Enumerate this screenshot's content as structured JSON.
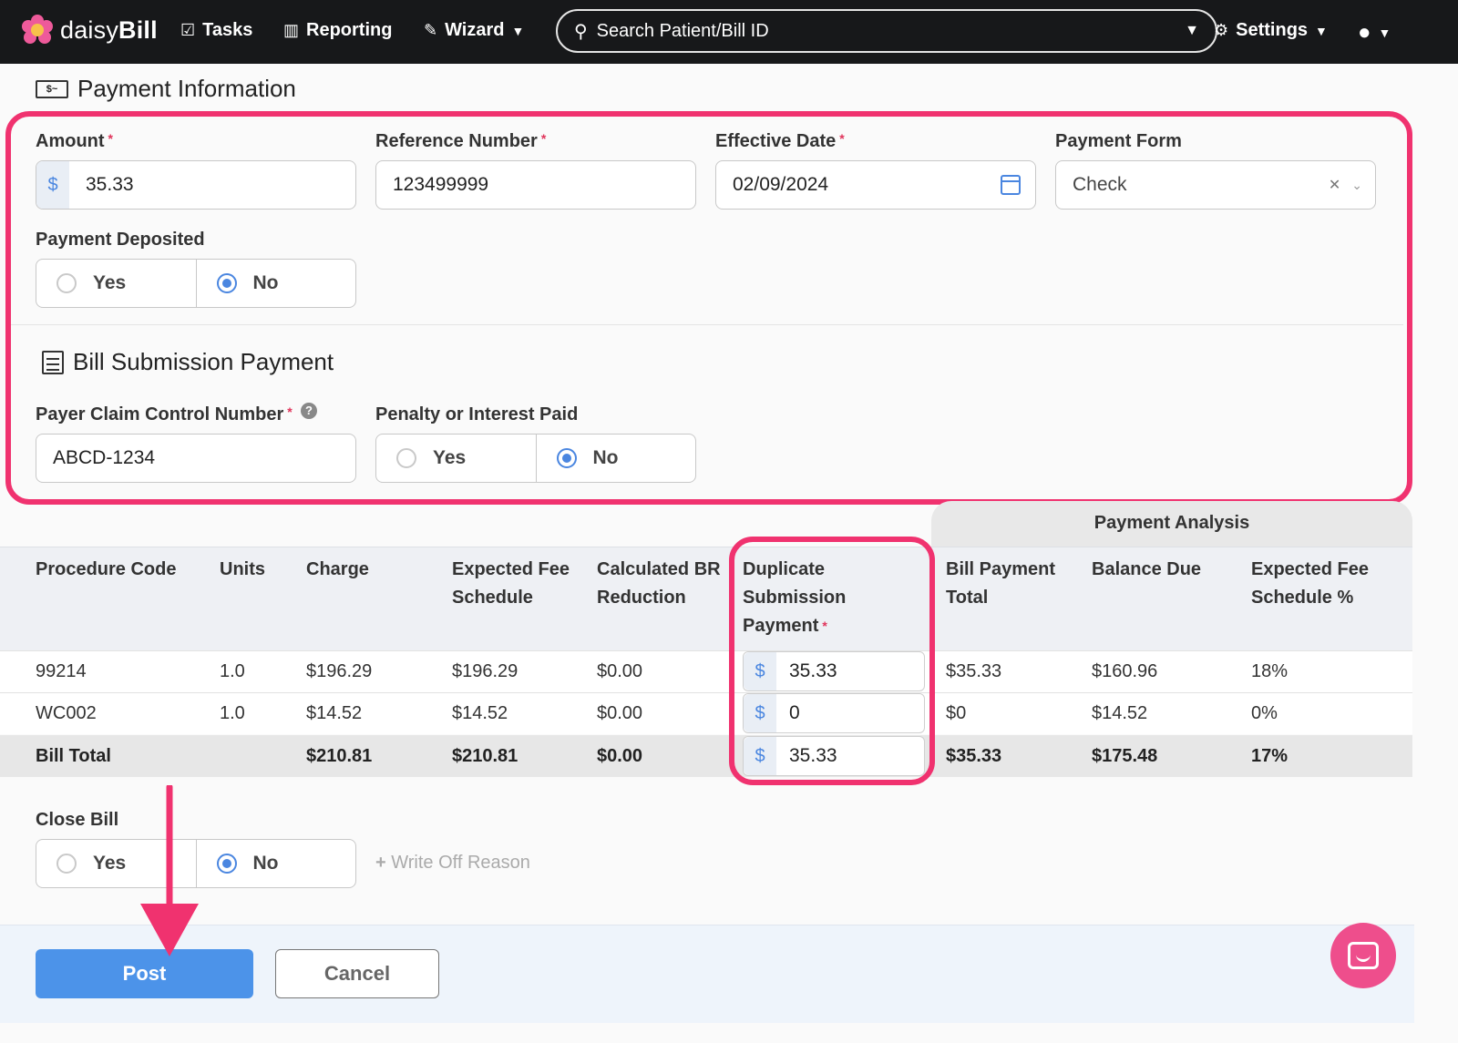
{
  "nav": {
    "brand_light": "daisy",
    "brand_bold": "Bill",
    "tasks": "Tasks",
    "reporting": "Reporting",
    "wizard": "Wizard",
    "search_placeholder": "Search Patient/Bill ID",
    "settings": "Settings"
  },
  "payment_info": {
    "title": "Payment Information",
    "amount_label": "Amount",
    "amount_value": "35.33",
    "currency": "$",
    "reference_label": "Reference Number",
    "reference_value": "123499999",
    "date_label": "Effective Date",
    "date_value": "02/09/2024",
    "form_label": "Payment Form",
    "form_value": "Check",
    "deposited_label": "Payment Deposited",
    "yes": "Yes",
    "no": "No",
    "deposited_selected": "No"
  },
  "bill_submission": {
    "title": "Bill Submission Payment",
    "pccn_label": "Payer Claim Control Number",
    "pccn_value": "ABCD-1234",
    "penalty_label": "Penalty or Interest Paid",
    "penalty_selected": "No"
  },
  "table": {
    "analysis_header": "Payment Analysis",
    "headers": {
      "procedure": "Procedure Code",
      "units": "Units",
      "charge": "Charge",
      "fee_1": "Expected Fee",
      "fee_2": "Schedule",
      "br_1": "Calculated BR",
      "br_2": "Reduction",
      "dup_1": "Duplicate",
      "dup_2": "Submission",
      "dup_3": "Payment",
      "bpt_1": "Bill Payment",
      "bpt_2": "Total",
      "balance": "Balance Due",
      "pct_1": "Expected Fee",
      "pct_2": "Schedule %"
    },
    "rows": [
      {
        "code": "99214",
        "units": "1.0",
        "charge": "$196.29",
        "fee": "$196.29",
        "br": "$0.00",
        "dup": "35.33",
        "bpt": "$35.33",
        "balance": "$160.96",
        "pct": "18%"
      },
      {
        "code": "WC002",
        "units": "1.0",
        "charge": "$14.52",
        "fee": "$14.52",
        "br": "$0.00",
        "dup": "0",
        "bpt": "$0",
        "balance": "$14.52",
        "pct": "0%"
      }
    ],
    "total": {
      "label": "Bill Total",
      "charge": "$210.81",
      "fee": "$210.81",
      "br": "$0.00",
      "dup": "35.33",
      "bpt": "$35.33",
      "balance": "$175.48",
      "pct": "17%"
    }
  },
  "close_bill": {
    "label": "Close Bill",
    "selected": "No",
    "write_off": "Write Off Reason"
  },
  "footer": {
    "post": "Post",
    "cancel": "Cancel"
  },
  "colors": {
    "highlight": "#f0326f",
    "primary": "#4c93e9",
    "nav_bg": "#17181a"
  }
}
